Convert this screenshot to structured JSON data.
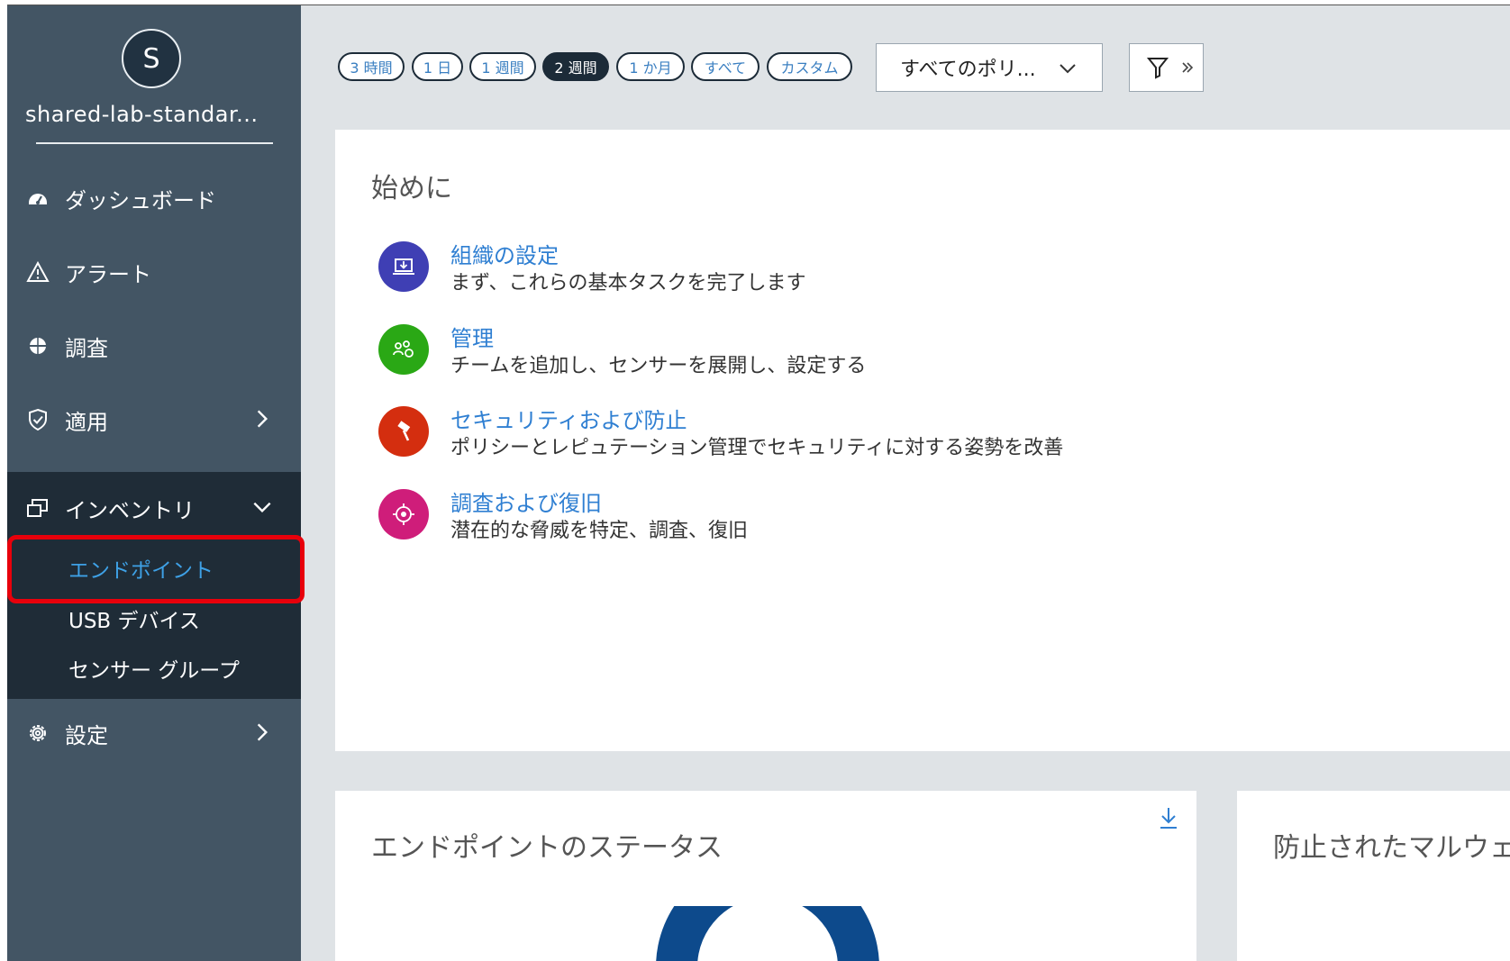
{
  "org": {
    "avatar_letter": "S",
    "name": "shared-lab-standar..."
  },
  "nav": {
    "items": [
      {
        "label": "ダッシュボード",
        "icon": "dashboard-gauge-icon"
      },
      {
        "label": "アラート",
        "icon": "warning-triangle-icon"
      },
      {
        "label": "調査",
        "icon": "investigate-icon"
      },
      {
        "label": "適用",
        "icon": "shield-check-icon"
      },
      {
        "label": "インベントリ",
        "icon": "inventory-icon"
      },
      {
        "label": "設定",
        "icon": "gear-icon"
      }
    ],
    "inventory_sub": [
      {
        "label": "エンドポイント",
        "active": true
      },
      {
        "label": "USB デバイス",
        "active": false
      },
      {
        "label": "センサー グループ",
        "active": false
      }
    ]
  },
  "time_filters": [
    "3 時間",
    "1 日",
    "1 週間",
    "2 週間",
    "1 か月",
    "すべて",
    "カスタム"
  ],
  "time_filters_selected": "2 週間",
  "policy_dropdown": {
    "value": "すべてのポリ..."
  },
  "filter": {
    "icon": "funnel-icon",
    "expand_icon": "double-chevron-right-icon"
  },
  "getting_started": {
    "title": "始めに",
    "items": [
      {
        "title": "組織の設定",
        "desc": "まず、これらの基本タスクを完了します",
        "icon": "setup-laptop-icon",
        "color": "#3f3fb4"
      },
      {
        "title": "管理",
        "desc": "チームを追加し、センサーを展開し、設定する",
        "icon": "team-icon",
        "color": "#2aa815"
      },
      {
        "title": "セキュリティおよび防止",
        "desc": "ポリシーとレピュテーション管理でセキュリティに対する姿勢を改善",
        "icon": "gavel-icon",
        "color": "#d42e0f"
      },
      {
        "title": "調査および復旧",
        "desc": "潜在的な脅威を特定、調査、復旧",
        "icon": "target-icon",
        "color": "#cf1d7a"
      }
    ]
  },
  "endpoint_status": {
    "title": "エンドポイントのステータス",
    "download_icon": "download-icon"
  },
  "malware_card": {
    "title": "防止されたマルウェ"
  },
  "colors": {
    "sidebar": "#435564",
    "sidebar_dark": "#1f2c37",
    "accent": "#2f7fd2",
    "highlight": "#e8000b",
    "donut": "#0d4a8c"
  }
}
